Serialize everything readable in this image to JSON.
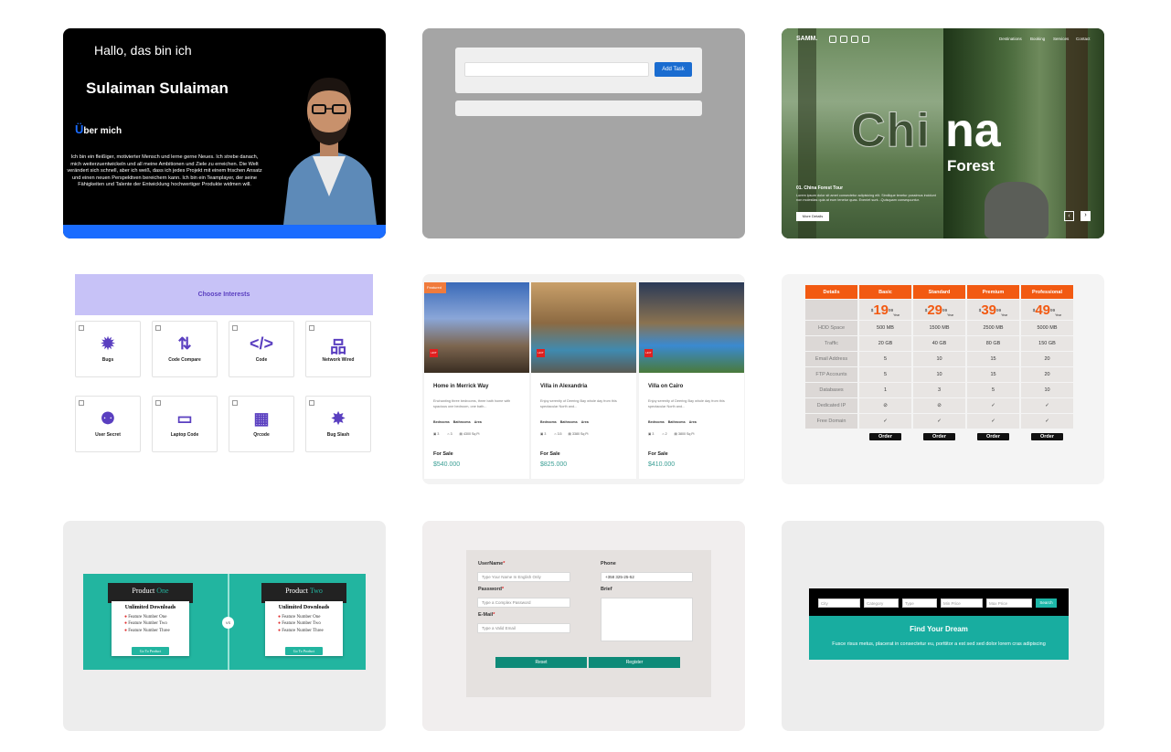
{
  "card1": {
    "greeting": "Hallo, das bin ich",
    "name": "Sulaiman Sulaiman",
    "about_first": "Ü",
    "about_rest": "ber mich",
    "bio": "Ich bin ein fleißiger, motivierter Mensch und lerne gerne Neues. Ich strebe danach, mich weiterzuentwickeln und all meine Ambitionen und Ziele zu erreichen. Die Welt verändert sich schnell, aber ich weiß, dass ich jedes Projekt mit einem frischen Ansatz und einen neuen Perspektiven bereichern kann. Ich bin ein Teamplayer, der seine Fähigkeiten und Talente der Entwicklung hochwertiger Produkte widmen will.",
    "accent": "#1a6cff"
  },
  "card2": {
    "add_label": "Add Task",
    "input_value": ""
  },
  "card3": {
    "logo": "SAMM.",
    "nav": [
      "Destinations",
      "Booking",
      "Services",
      "Contact"
    ],
    "big_left": "Chi",
    "big_right": "na",
    "sub": "Forest",
    "tour": "01. China Forest Tour",
    "desc": "Lorem ipsum dolor sit amet consectetur adipisicing elit. Similique tenetur possimus incidunt non molestias quia at eum tenetur quas. Eveniet sunt...Quisquam consequuntur.",
    "more": "More Details",
    "prev": "‹",
    "next": "›"
  },
  "card4": {
    "title": "Choose Interests",
    "items": [
      {
        "label": "Bugs",
        "icon": "bug-icon",
        "glyph": "✹"
      },
      {
        "label": "Code Compare",
        "icon": "code-compare-icon",
        "glyph": "⇅"
      },
      {
        "label": "Code",
        "icon": "code-icon",
        "glyph": "</>"
      },
      {
        "label": "Network Wired",
        "icon": "network-wired-icon",
        "glyph": "品"
      },
      {
        "label": "User Secret",
        "icon": "user-secret-icon",
        "glyph": "⚉"
      },
      {
        "label": "Laptop Code",
        "icon": "laptop-code-icon",
        "glyph": "▭"
      },
      {
        "label": "Qrcode",
        "icon": "qrcode-icon",
        "glyph": "▦"
      },
      {
        "label": "Bug Slash",
        "icon": "bug-slash-icon",
        "glyph": "✸"
      }
    ],
    "accent": "#5a3fc0"
  },
  "card5": {
    "featured": "Featured",
    "tag": "HOT",
    "headers": [
      "Bedrooms",
      "Bathrooms",
      "Area"
    ],
    "sale": "For Sale",
    "listings": [
      {
        "title": "Home in Merrick Way",
        "desc": "Enchanting three bedrooms, three bath home with spacious one bedroom, one bath...",
        "beds": "3",
        "baths": "3",
        "area": "4300 Sq Ft",
        "price": "$540.000"
      },
      {
        "title": "Villa in Alexandria",
        "desc": "Enjoy serenity of Deering Bay whole day from this spectacular North and...",
        "beds": "3",
        "baths": "3.5",
        "area": "3380 Sq Ft",
        "price": "$825.000"
      },
      {
        "title": "Villa on Cairo",
        "desc": "Enjoy serenity of Deering Bay whole day from this spectacular North and...",
        "beds": "3",
        "baths": "2",
        "area": "3800 Sq Ft",
        "price": "$410.000"
      }
    ]
  },
  "card6": {
    "headers": [
      "Details",
      "Basic",
      "Standard",
      "Premium",
      "Professional"
    ],
    "prices": [
      "19",
      "29",
      "39",
      "49"
    ],
    "currency": "$",
    "cents": "99",
    "per": "Year",
    "rows": [
      {
        "label": "HDD Space",
        "values": [
          "500 MB",
          "1500 MB",
          "2500 MB",
          "5000 MB"
        ]
      },
      {
        "label": "Traffic",
        "values": [
          "20 GB",
          "40 GB",
          "80 GB",
          "150 GB"
        ]
      },
      {
        "label": "Email Address",
        "values": [
          "5",
          "10",
          "15",
          "20"
        ]
      },
      {
        "label": "FTP Accounts",
        "values": [
          "5",
          "10",
          "15",
          "20"
        ]
      },
      {
        "label": "Databases",
        "values": [
          "1",
          "3",
          "5",
          "10"
        ]
      },
      {
        "label": "Dedicated IP",
        "values": [
          "⊘",
          "⊘",
          "✓",
          "✓"
        ]
      },
      {
        "label": "Free Domain",
        "values": [
          "✓",
          "✓",
          "✓",
          "✓"
        ]
      }
    ],
    "order": "Order"
  },
  "card7": {
    "product_word": "Product",
    "products": [
      {
        "num": "One",
        "plan": "Unlimited Downloads",
        "features": [
          "Feature Number One",
          "Feature Number Two",
          "Feature Number Three"
        ],
        "cta": "Go To Product"
      },
      {
        "num": "Two",
        "plan": "Unlimited Downloads",
        "features": [
          "Feature Number One",
          "Feature Number Two",
          "Feature Number Three"
        ],
        "cta": "Go To Product"
      }
    ],
    "vs": "VS"
  },
  "card8": {
    "username_label": "UserName",
    "username_ph": "Type Your Name In English Only",
    "password_label": "Password",
    "password_ph": "Type a Complex Password",
    "email_label": "E-Mail",
    "email_ph": "Type a Valid Email",
    "phone_label": "Phone",
    "phone_value": "+358 325-25-52",
    "brief_label": "Brief",
    "required": "*",
    "reset": "Reset",
    "register": "Register"
  },
  "card9": {
    "fields": [
      "City",
      "Category",
      "Type",
      "Min Price",
      "Max Price"
    ],
    "search": "Search",
    "title": "Find Your Dream",
    "sub": "Fusce risus metus, placerat in consectetur eu, porttitor a est sed sed dolor lorem cras adipiscing"
  }
}
